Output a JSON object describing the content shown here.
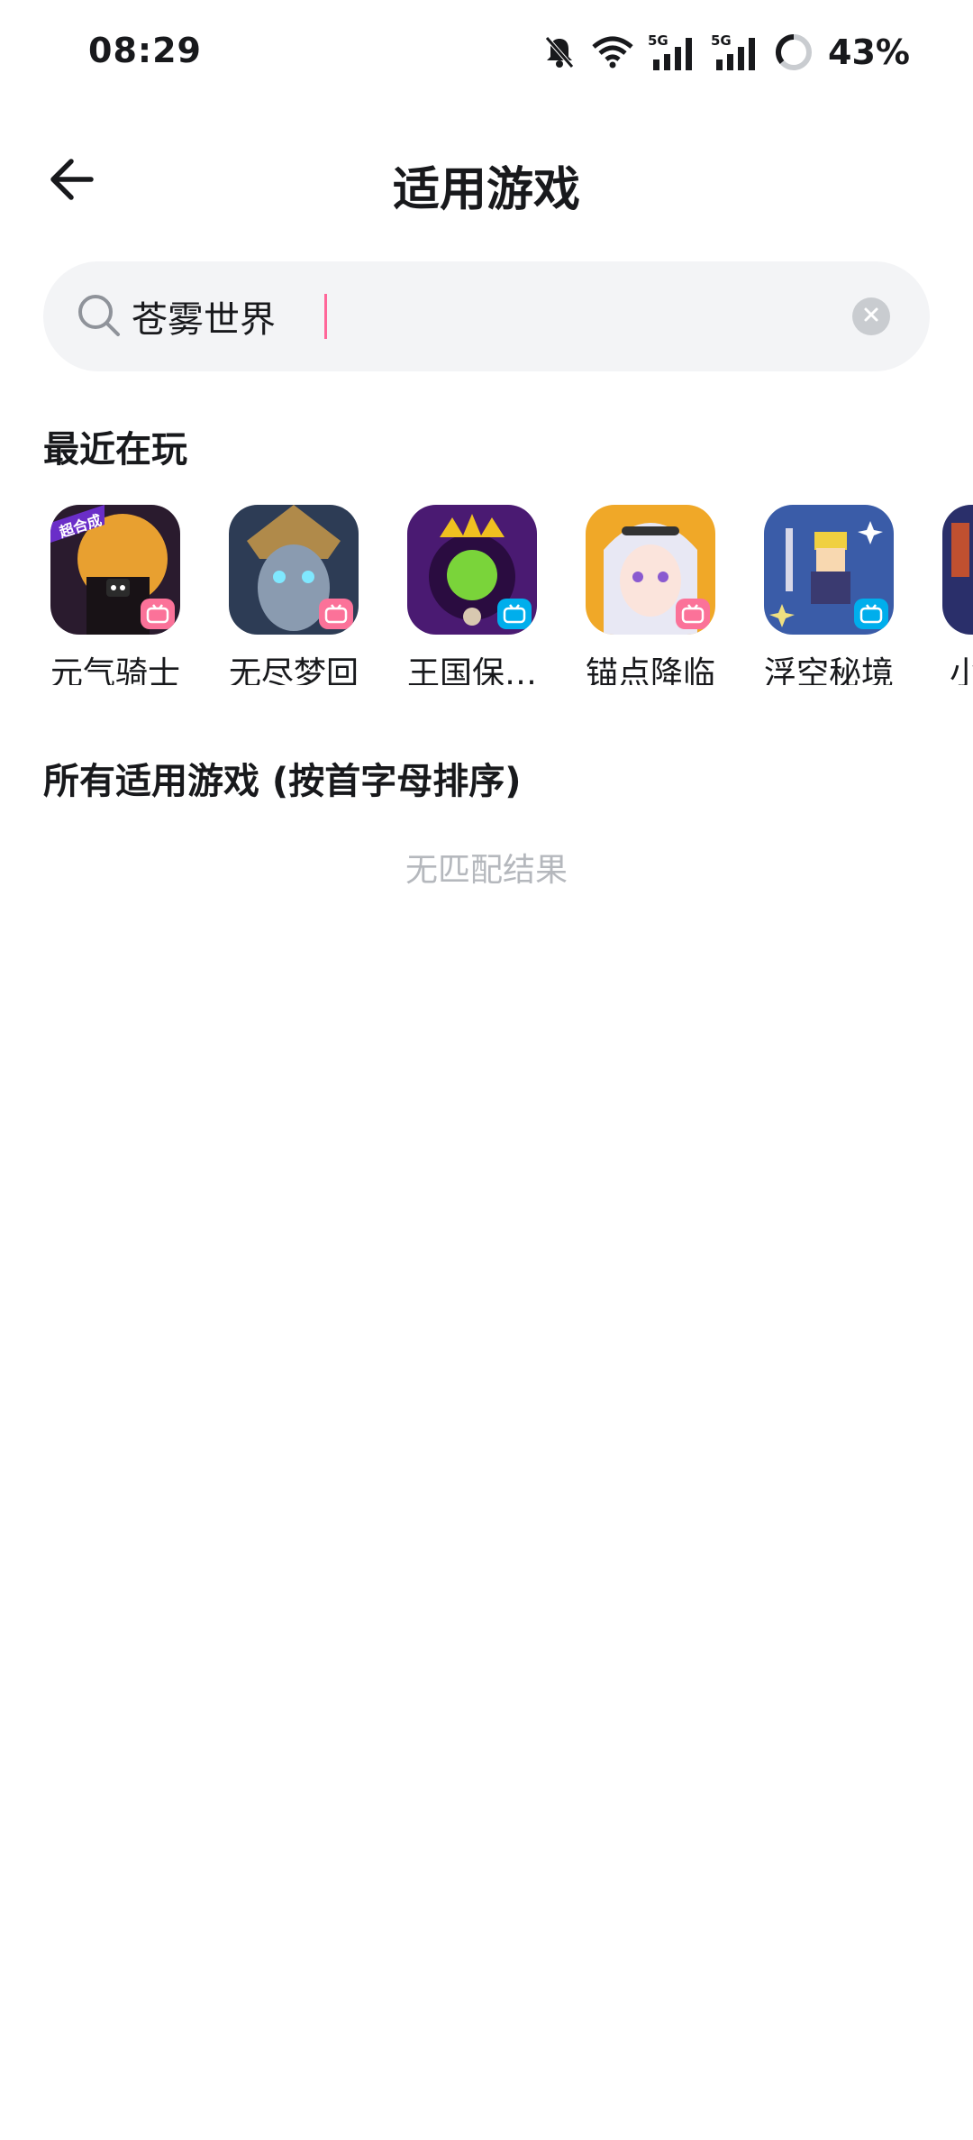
{
  "status_bar": {
    "time": "08:29",
    "battery": "43%",
    "icons": [
      "mute-bell-icon",
      "wifi-icon",
      "5g-signal-icon",
      "5g-signal-icon",
      "battery-ring-icon"
    ]
  },
  "header": {
    "title": "适用游戏",
    "back_icon": "arrow-left-icon"
  },
  "search": {
    "value": "苍雾世界",
    "placeholder": ""
  },
  "recent": {
    "title": "最近在玩",
    "games": [
      {
        "name": "元气骑士",
        "badge_color": "#fb7299"
      },
      {
        "name": "无尽梦回",
        "badge_color": "#fb7299"
      },
      {
        "name": "王国保…",
        "badge_color": "#00aeec"
      },
      {
        "name": "锚点降临",
        "badge_color": "#fb7299"
      },
      {
        "name": "浮空秘境",
        "badge_color": "#00aeec"
      },
      {
        "name": "小",
        "badge_color": "#fb7299"
      }
    ]
  },
  "all_games": {
    "title": "所有适用游戏 (按首字母排序)",
    "empty_text": "无匹配结果"
  },
  "colors": {
    "accent_pink": "#fb7299",
    "accent_blue": "#00aeec",
    "search_bg": "#f3f4f6",
    "muted_text": "#b5b8bd"
  }
}
